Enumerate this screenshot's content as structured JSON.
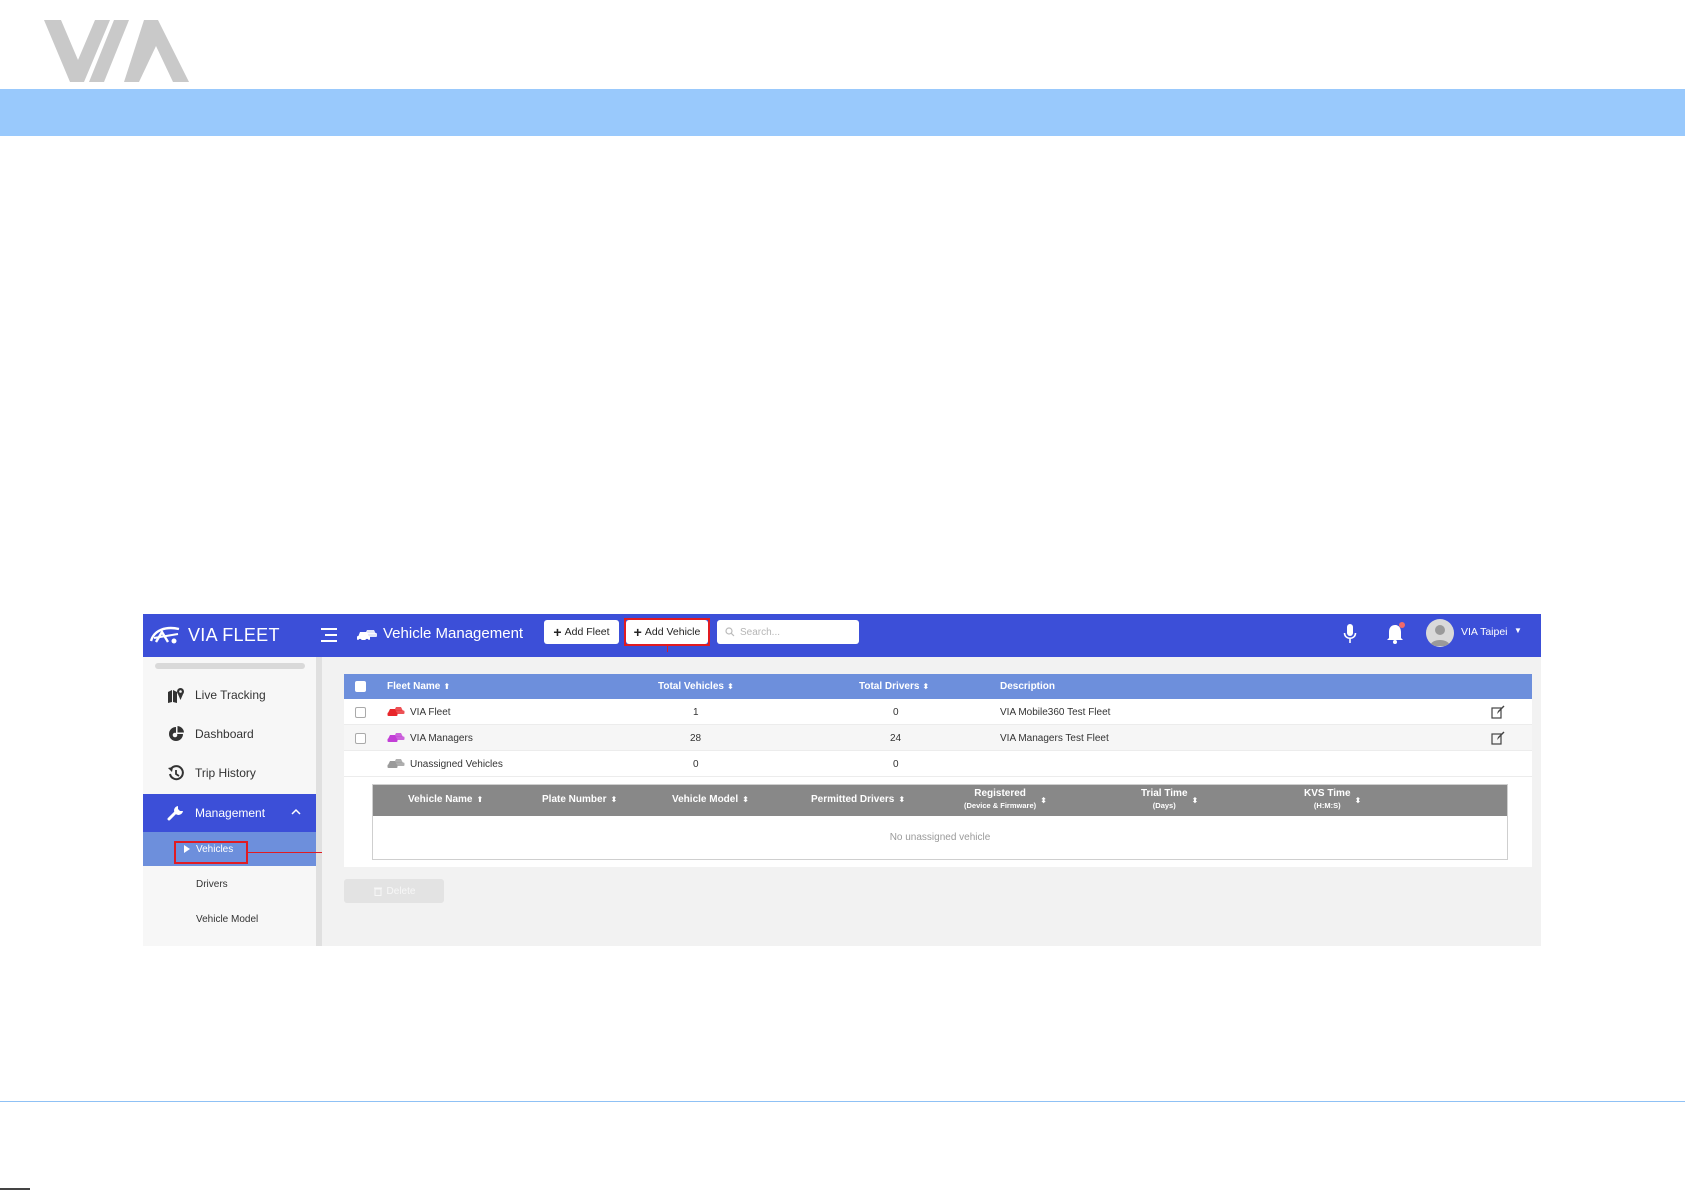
{
  "doc": {
    "logo_text": "VIA"
  },
  "app": {
    "brand": "VIA FLEET",
    "page_title": "Vehicle Management",
    "toolbar": {
      "add_fleet_label": "Add Fleet",
      "add_vehicle_label": "Add Vehicle",
      "search_placeholder": "Search..."
    },
    "user": {
      "name": "VIA Taipei"
    },
    "sidebar": {
      "items": [
        {
          "label": "Live Tracking",
          "icon": "map-marker-icon"
        },
        {
          "label": "Dashboard",
          "icon": "pie-chart-icon"
        },
        {
          "label": "Trip History",
          "icon": "history-icon"
        },
        {
          "label": "Management",
          "icon": "wrench-icon"
        }
      ],
      "sub_items": [
        {
          "label": "Vehicles",
          "active": true
        },
        {
          "label": "Drivers",
          "active": false
        },
        {
          "label": "Vehicle Model",
          "active": false
        }
      ]
    },
    "fleet_table": {
      "headers": [
        "Fleet Name",
        "Total Vehicles",
        "Total Drivers",
        "Description"
      ],
      "rows": [
        {
          "name": "VIA Fleet",
          "vehicles": "1",
          "drivers": "0",
          "description": "VIA Mobile360 Test Fleet",
          "color": "#e8262b"
        },
        {
          "name": "VIA Managers",
          "vehicles": "28",
          "drivers": "24",
          "description": "VIA Managers Test Fleet",
          "color": "#c23fd6"
        },
        {
          "name": "Unassigned Vehicles",
          "vehicles": "0",
          "drivers": "0",
          "description": "",
          "color": "#9a9a9a"
        }
      ]
    },
    "vehicle_table": {
      "headers": {
        "vehicle_name": "Vehicle Name",
        "plate_number": "Plate Number",
        "vehicle_model": "Vehicle Model",
        "permitted_drivers": "Permitted Drivers",
        "registered": "Registered",
        "registered_sub": "(Device & Firmware)",
        "trial_time": "Trial Time",
        "trial_time_sub": "(Days)",
        "kvs_time": "KVS Time",
        "kvs_time_sub": "(H:M:S)"
      },
      "empty_message": "No unassigned vehicle"
    },
    "delete_label": "Delete",
    "colors": {
      "topbar": "#3c4fd8",
      "table_header": "#6d8fdc",
      "highlight": "#e11b22",
      "doc_band": "#99c9fc"
    }
  }
}
